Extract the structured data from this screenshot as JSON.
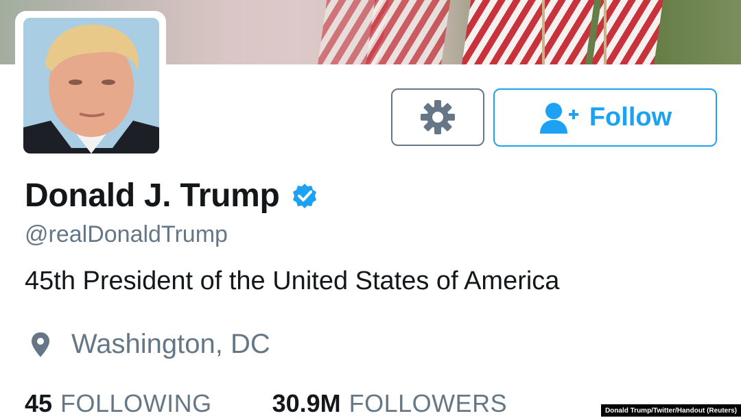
{
  "profile": {
    "name": "Donald J. Trump",
    "handle": "@realDonaldTrump",
    "bio": "45th President of the United States of America",
    "location": "Washington, DC",
    "verified": true
  },
  "actions": {
    "settings_icon": "gear-icon",
    "follow_icon": "add-user-icon",
    "follow_label": "Follow"
  },
  "stats": {
    "following_count": "45",
    "following_label": "FOLLOWING",
    "followers_count": "30.9M",
    "followers_label": "FOLLOWERS"
  },
  "credit": "Donald Trump/Twitter/Handout (Reuters)",
  "colors": {
    "accent": "#1da1f2",
    "text": "#14171a",
    "secondary": "#657786"
  }
}
